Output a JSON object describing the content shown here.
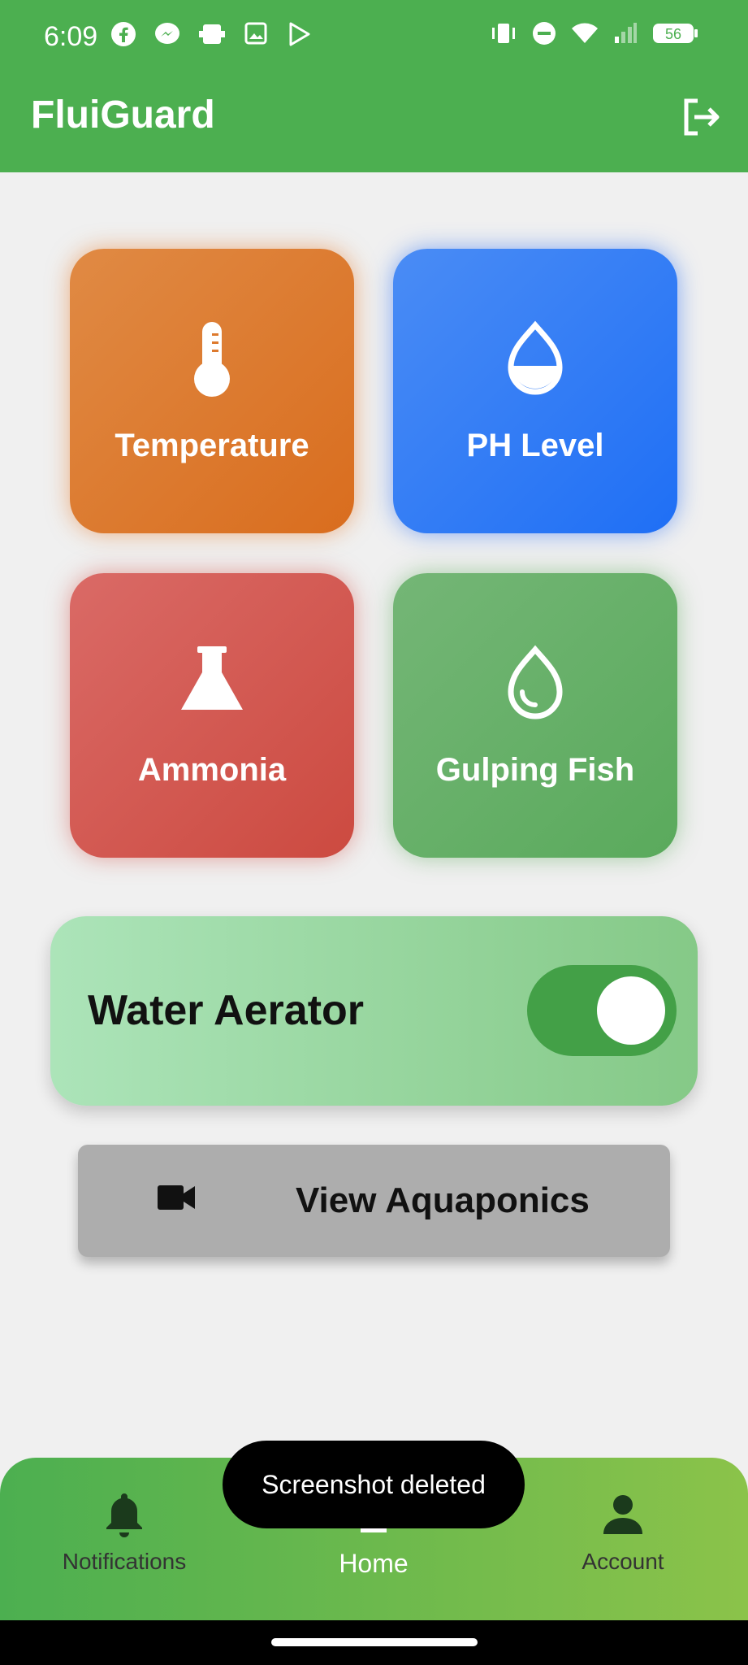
{
  "status": {
    "time": "6:09",
    "battery": "56",
    "left_icons": [
      "facebook-icon",
      "messenger-icon",
      "media-icon",
      "image-icon",
      "play-icon"
    ],
    "right_icons": [
      "vibrate-icon",
      "dnd-icon",
      "wifi-icon",
      "signal-icon",
      "battery-icon"
    ]
  },
  "app": {
    "title": "FluiGuard",
    "logout_icon": "logout-icon"
  },
  "tiles": [
    {
      "label": "Temperature",
      "icon": "thermometer-icon",
      "color": "#dd7a2e"
    },
    {
      "label": "PH Level",
      "icon": "water-drop-half-icon",
      "color": "#2a78f5"
    },
    {
      "label": "Ammonia",
      "icon": "flask-icon",
      "color": "#d45a52"
    },
    {
      "label": "Gulping Fish",
      "icon": "water-drop-icon",
      "color": "#66b068"
    }
  ],
  "aerator": {
    "label": "Water Aerator",
    "on": true,
    "toggle_color": "#43a047"
  },
  "view_button": {
    "label": "View Aquaponics",
    "icon": "video-camera-icon"
  },
  "toast": {
    "text": "Screenshot deleted"
  },
  "nav": [
    {
      "label": "Notifications",
      "icon": "bell-icon"
    },
    {
      "label": "Home",
      "icon": "home-icon",
      "active": true
    },
    {
      "label": "Account",
      "icon": "person-icon"
    }
  ]
}
